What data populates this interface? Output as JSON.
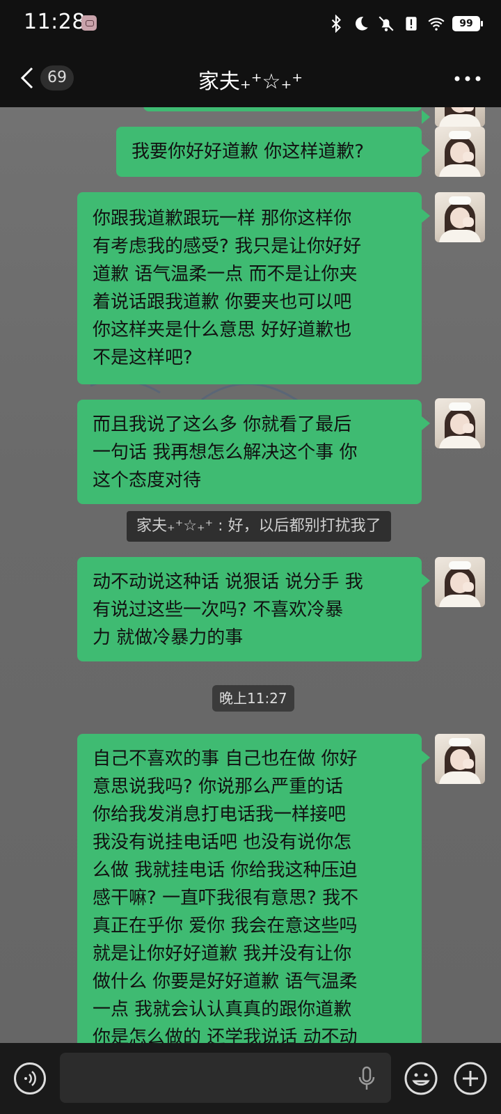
{
  "status_bar": {
    "time": "11:28",
    "battery": "99",
    "icons": [
      "notification-icon",
      "bluetooth-icon",
      "moon-icon",
      "bell-off-icon",
      "alert-icon",
      "wifi-icon",
      "battery-icon"
    ]
  },
  "header": {
    "back_icon": "chevron-left-icon",
    "unread_count": "69",
    "title": "家夫₊⁺☆₊⁺",
    "more_icon": "more-horizontal-icon"
  },
  "messages": [
    {
      "text": "我要你好好道歉 你这样道歉?"
    },
    {
      "text": "你跟我道歉跟玩一样 那你这样你\n有考虑我的感受? 我只是让你好好\n道歉 语气温柔一点 而不是让你夹\n着说话跟我道歉 你要夹也可以吧\n你这样夹是什么意思 好好道歉也\n不是这样吧?"
    },
    {
      "text": "而且我说了这么多 你就看了最后\n一句话 我再想怎么解决这个事 你\n这个态度对待"
    },
    {
      "text": "动不动说这种话 说狠话 说分手 我\n有说过这些一次吗? 不喜欢冷暴\n力 就做冷暴力的事"
    },
    {
      "text": "自己不喜欢的事 自己也在做 你好\n意思说我吗? 你说那么严重的话\n你给我发消息打电话我一样接吧\n我没有说挂电话吧 也没有说你怎\n么做 我就挂电话 你给我这种压迫\n感干嘛? 一直吓我很有意思? 我不\n真正在乎你 爱你 我会在意这些吗\n就是让你好好道歉 我并没有让你\n做什么 你要是好好道歉 语气温柔\n一点 我就会认认真真的跟你道歉\n你是怎么做的 还学我说话 动不动"
    }
  ],
  "recall_notice": "家夫₊⁺☆₊⁺ : 好，以后都别打扰我了",
  "timestamp": "晚上11:27",
  "input_bar": {
    "voice_icon": "voice-icon",
    "mic_icon": "microphone-icon",
    "emoji_icon": "emoji-icon",
    "plus_icon": "plus-icon",
    "value": ""
  },
  "colors": {
    "bubble": "#3fbb72",
    "bar": "#111111",
    "chat_bg": "#6d6d6d"
  }
}
